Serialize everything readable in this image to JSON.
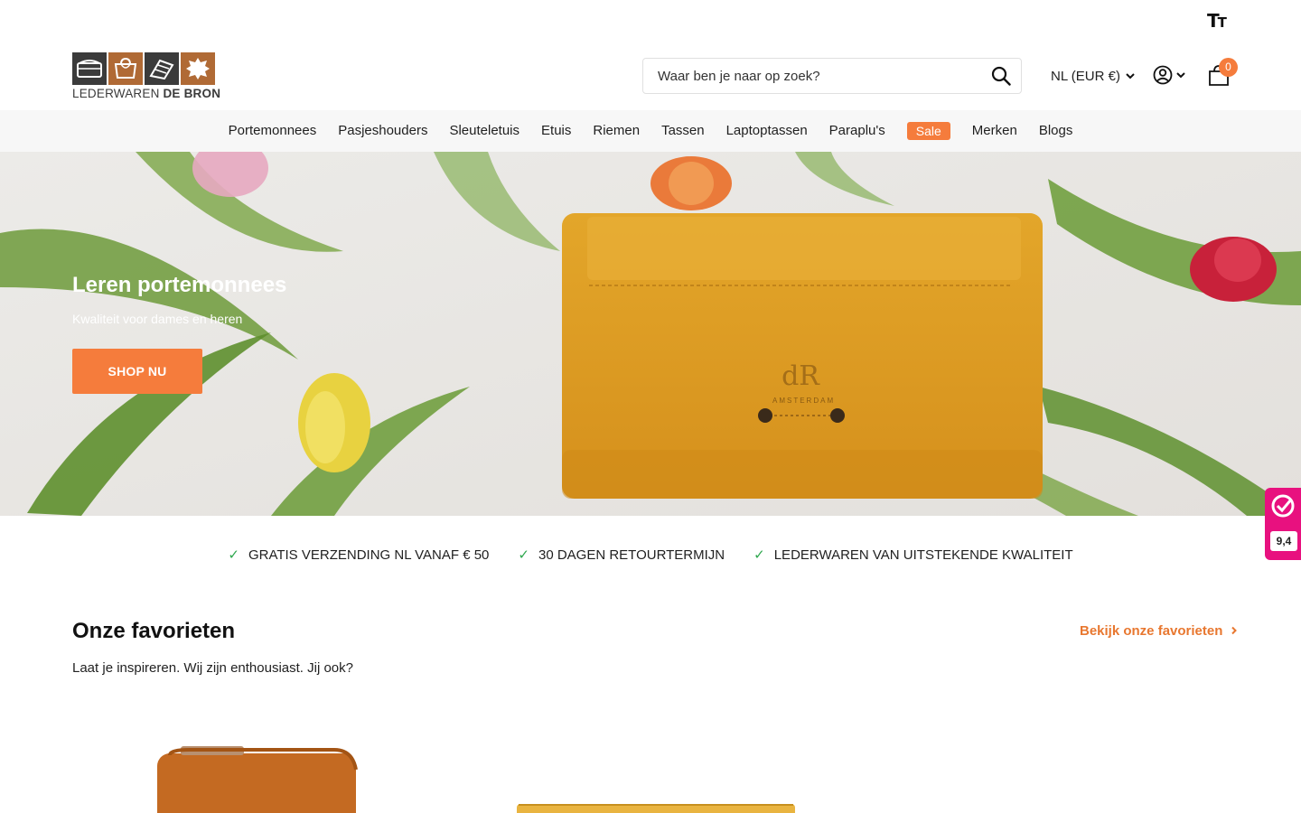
{
  "header": {
    "logo_text_light": "LEDERWAREN",
    "logo_text_bold": "DE BRON",
    "text_size_label": "T",
    "text_size_label_small": "T",
    "search_placeholder": "Waar ben je naar op zoek?",
    "locale_label": "NL (EUR €)",
    "cart_count": "0"
  },
  "nav": {
    "items": [
      "Portemonnees",
      "Pasjeshouders",
      "Sleuteletuis",
      "Etuis",
      "Riemen",
      "Tassen",
      "Laptoptassen",
      "Paraplu's",
      "Sale",
      "Merken",
      "Blogs"
    ]
  },
  "hero": {
    "title": "Leren portemonnees",
    "subtitle": "Kwaliteit voor dames en heren",
    "button_label": "SHOP NU",
    "product_brand": "AMSTERDAM"
  },
  "usps": [
    "GRATIS VERZENDING NL VANAF € 50",
    "30 DAGEN RETOURTERMIJN",
    "LEDERWAREN VAN UITSTEKENDE KWALITEIT"
  ],
  "favorites": {
    "title": "Onze favorieten",
    "subtitle": "Laat je inspireren. Wij zijn enthousiast. Jij ook?",
    "link_label": "Bekijk onze favorieten"
  },
  "review_badge": {
    "score": "9,4"
  },
  "colors": {
    "accent": "#f57c3c",
    "link": "#e8772f",
    "check": "#2fa84f",
    "review": "#e8117f",
    "nav_bg": "#f7f7f7"
  }
}
